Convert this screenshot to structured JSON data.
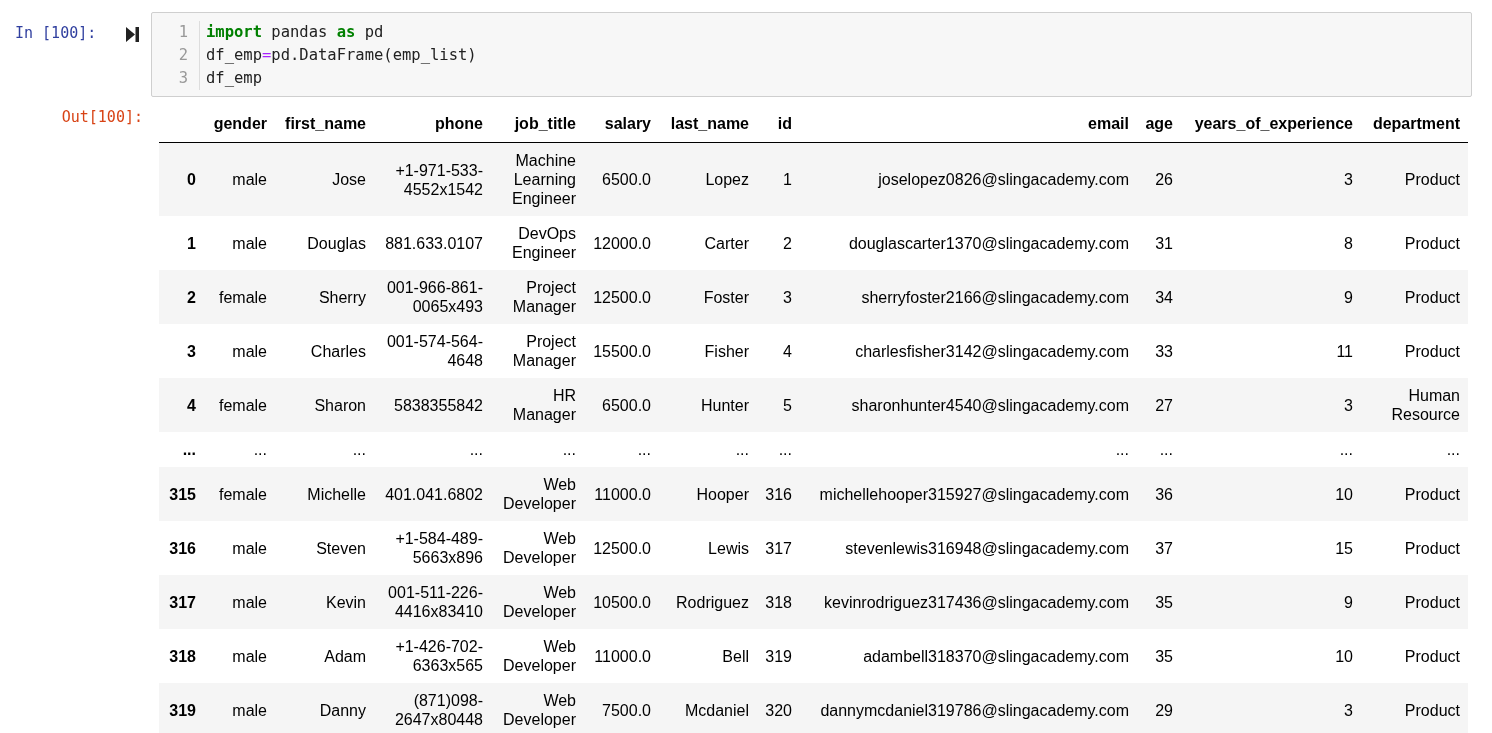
{
  "input_cell": {
    "prompt": "In [100]:",
    "lines": [
      {
        "number": "1",
        "tokens": [
          {
            "text": "import",
            "kind": "keyword"
          },
          {
            "text": " pandas ",
            "kind": "plain"
          },
          {
            "text": "as",
            "kind": "keyword"
          },
          {
            "text": " pd",
            "kind": "plain"
          }
        ]
      },
      {
        "number": "2",
        "tokens": [
          {
            "text": "df_emp",
            "kind": "plain"
          },
          {
            "text": "=",
            "kind": "operator"
          },
          {
            "text": "pd.DataFrame(emp_list)",
            "kind": "plain"
          }
        ]
      },
      {
        "number": "3",
        "tokens": [
          {
            "text": "df_emp",
            "kind": "plain"
          }
        ]
      }
    ]
  },
  "output_cell": {
    "prompt": "Out[100]:",
    "table": {
      "columns": [
        "gender",
        "first_name",
        "phone",
        "job_title",
        "salary",
        "last_name",
        "id",
        "email",
        "age",
        "years_of_experience",
        "department"
      ],
      "rows": [
        {
          "index": "0",
          "cells": [
            "male",
            "Jose",
            "+1-971-533-4552x1542",
            "Machine Learning Engineer",
            "6500.0",
            "Lopez",
            "1",
            "joselopez0826@slingacademy.com",
            "26",
            "3",
            "Product"
          ]
        },
        {
          "index": "1",
          "cells": [
            "male",
            "Douglas",
            "881.633.0107",
            "DevOps Engineer",
            "12000.0",
            "Carter",
            "2",
            "douglascarter1370@slingacademy.com",
            "31",
            "8",
            "Product"
          ]
        },
        {
          "index": "2",
          "cells": [
            "female",
            "Sherry",
            "001-966-861-0065x493",
            "Project Manager",
            "12500.0",
            "Foster",
            "3",
            "sherryfoster2166@slingacademy.com",
            "34",
            "9",
            "Product"
          ]
        },
        {
          "index": "3",
          "cells": [
            "male",
            "Charles",
            "001-574-564-4648",
            "Project Manager",
            "15500.0",
            "Fisher",
            "4",
            "charlesfisher3142@slingacademy.com",
            "33",
            "11",
            "Product"
          ]
        },
        {
          "index": "4",
          "cells": [
            "female",
            "Sharon",
            "5838355842",
            "HR Manager",
            "6500.0",
            "Hunter",
            "5",
            "sharonhunter4540@slingacademy.com",
            "27",
            "3",
            "Human Resource"
          ]
        },
        {
          "index": "...",
          "cells": [
            "...",
            "...",
            "...",
            "...",
            "...",
            "...",
            "...",
            "...",
            "...",
            "...",
            "..."
          ]
        },
        {
          "index": "315",
          "cells": [
            "female",
            "Michelle",
            "401.041.6802",
            "Web Developer",
            "11000.0",
            "Hooper",
            "316",
            "michellehooper315927@slingacademy.com",
            "36",
            "10",
            "Product"
          ]
        },
        {
          "index": "316",
          "cells": [
            "male",
            "Steven",
            "+1-584-489-5663x896",
            "Web Developer",
            "12500.0",
            "Lewis",
            "317",
            "stevenlewis316948@slingacademy.com",
            "37",
            "15",
            "Product"
          ]
        },
        {
          "index": "317",
          "cells": [
            "male",
            "Kevin",
            "001-511-226-4416x83410",
            "Web Developer",
            "10500.0",
            "Rodriguez",
            "318",
            "kevinrodriguez317436@slingacademy.com",
            "35",
            "9",
            "Product"
          ]
        },
        {
          "index": "318",
          "cells": [
            "male",
            "Adam",
            "+1-426-702-6363x565",
            "Web Developer",
            "11000.0",
            "Bell",
            "319",
            "adambell318370@slingacademy.com",
            "35",
            "10",
            "Product"
          ]
        },
        {
          "index": "319",
          "cells": [
            "male",
            "Danny",
            "(871)098-2647x80448",
            "Web Developer",
            "7500.0",
            "Mcdaniel",
            "320",
            "dannymcdaniel319786@slingacademy.com",
            "29",
            "3",
            "Product"
          ]
        }
      ]
    }
  }
}
